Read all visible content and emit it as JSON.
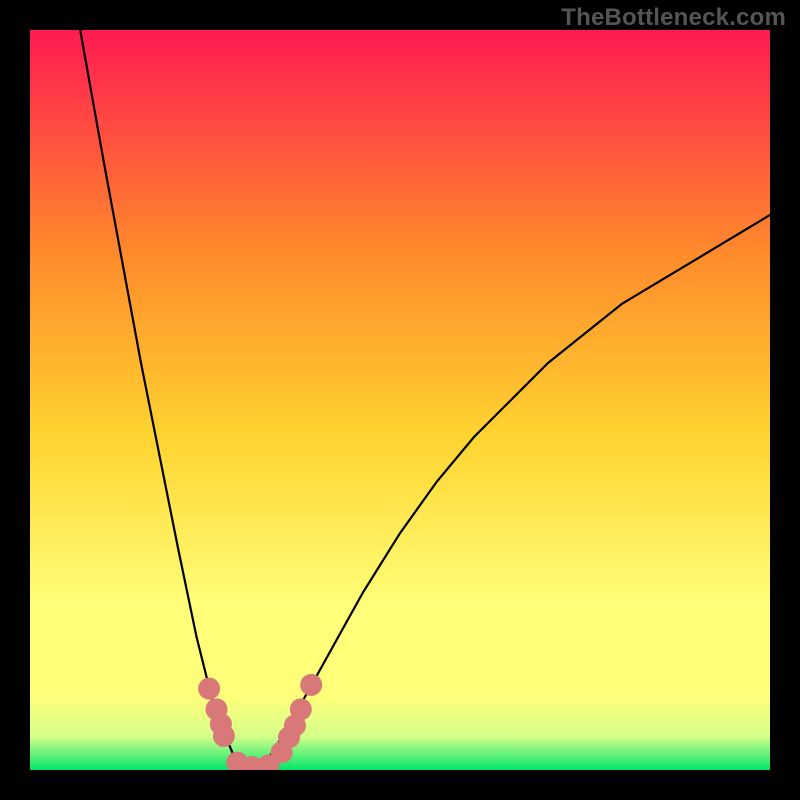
{
  "watermark": "TheBottleneck.com",
  "colors": {
    "background": "#000000",
    "gradient_top": "#ff1a52",
    "gradient_mid1": "#ff8a2b",
    "gradient_mid2": "#ffd430",
    "gradient_mid3": "#ffff7a",
    "gradient_mid4": "#d4ff8a",
    "gradient_bottom": "#00e56a",
    "curve": "#000000",
    "markers": "#d87878"
  },
  "chart_data": {
    "type": "line",
    "title": "",
    "xlabel": "",
    "ylabel": "",
    "xlim": [
      0,
      1
    ],
    "ylim": [
      0,
      1
    ],
    "series": [
      {
        "name": "bottleneck-curve",
        "x": [
          0.0,
          0.05,
          0.1,
          0.15,
          0.2,
          0.225,
          0.25,
          0.275,
          0.29,
          0.3,
          0.31,
          0.325,
          0.35,
          0.4,
          0.45,
          0.5,
          0.55,
          0.6,
          0.65,
          0.7,
          0.75,
          0.8,
          0.85,
          0.9,
          0.95,
          1.0
        ],
        "values": [
          1.4,
          1.1,
          0.82,
          0.55,
          0.3,
          0.18,
          0.08,
          0.02,
          0.005,
          0.0,
          0.005,
          0.02,
          0.06,
          0.15,
          0.24,
          0.32,
          0.39,
          0.45,
          0.5,
          0.55,
          0.59,
          0.63,
          0.66,
          0.69,
          0.72,
          0.75
        ]
      }
    ],
    "markers": [
      {
        "x": 0.242,
        "y": 0.11
      },
      {
        "x": 0.252,
        "y": 0.082
      },
      {
        "x": 0.258,
        "y": 0.062
      },
      {
        "x": 0.262,
        "y": 0.046
      },
      {
        "x": 0.28,
        "y": 0.01
      },
      {
        "x": 0.3,
        "y": 0.004
      },
      {
        "x": 0.322,
        "y": 0.006
      },
      {
        "x": 0.34,
        "y": 0.024
      },
      {
        "x": 0.35,
        "y": 0.044
      },
      {
        "x": 0.358,
        "y": 0.06
      },
      {
        "x": 0.366,
        "y": 0.082
      },
      {
        "x": 0.38,
        "y": 0.115
      }
    ]
  }
}
